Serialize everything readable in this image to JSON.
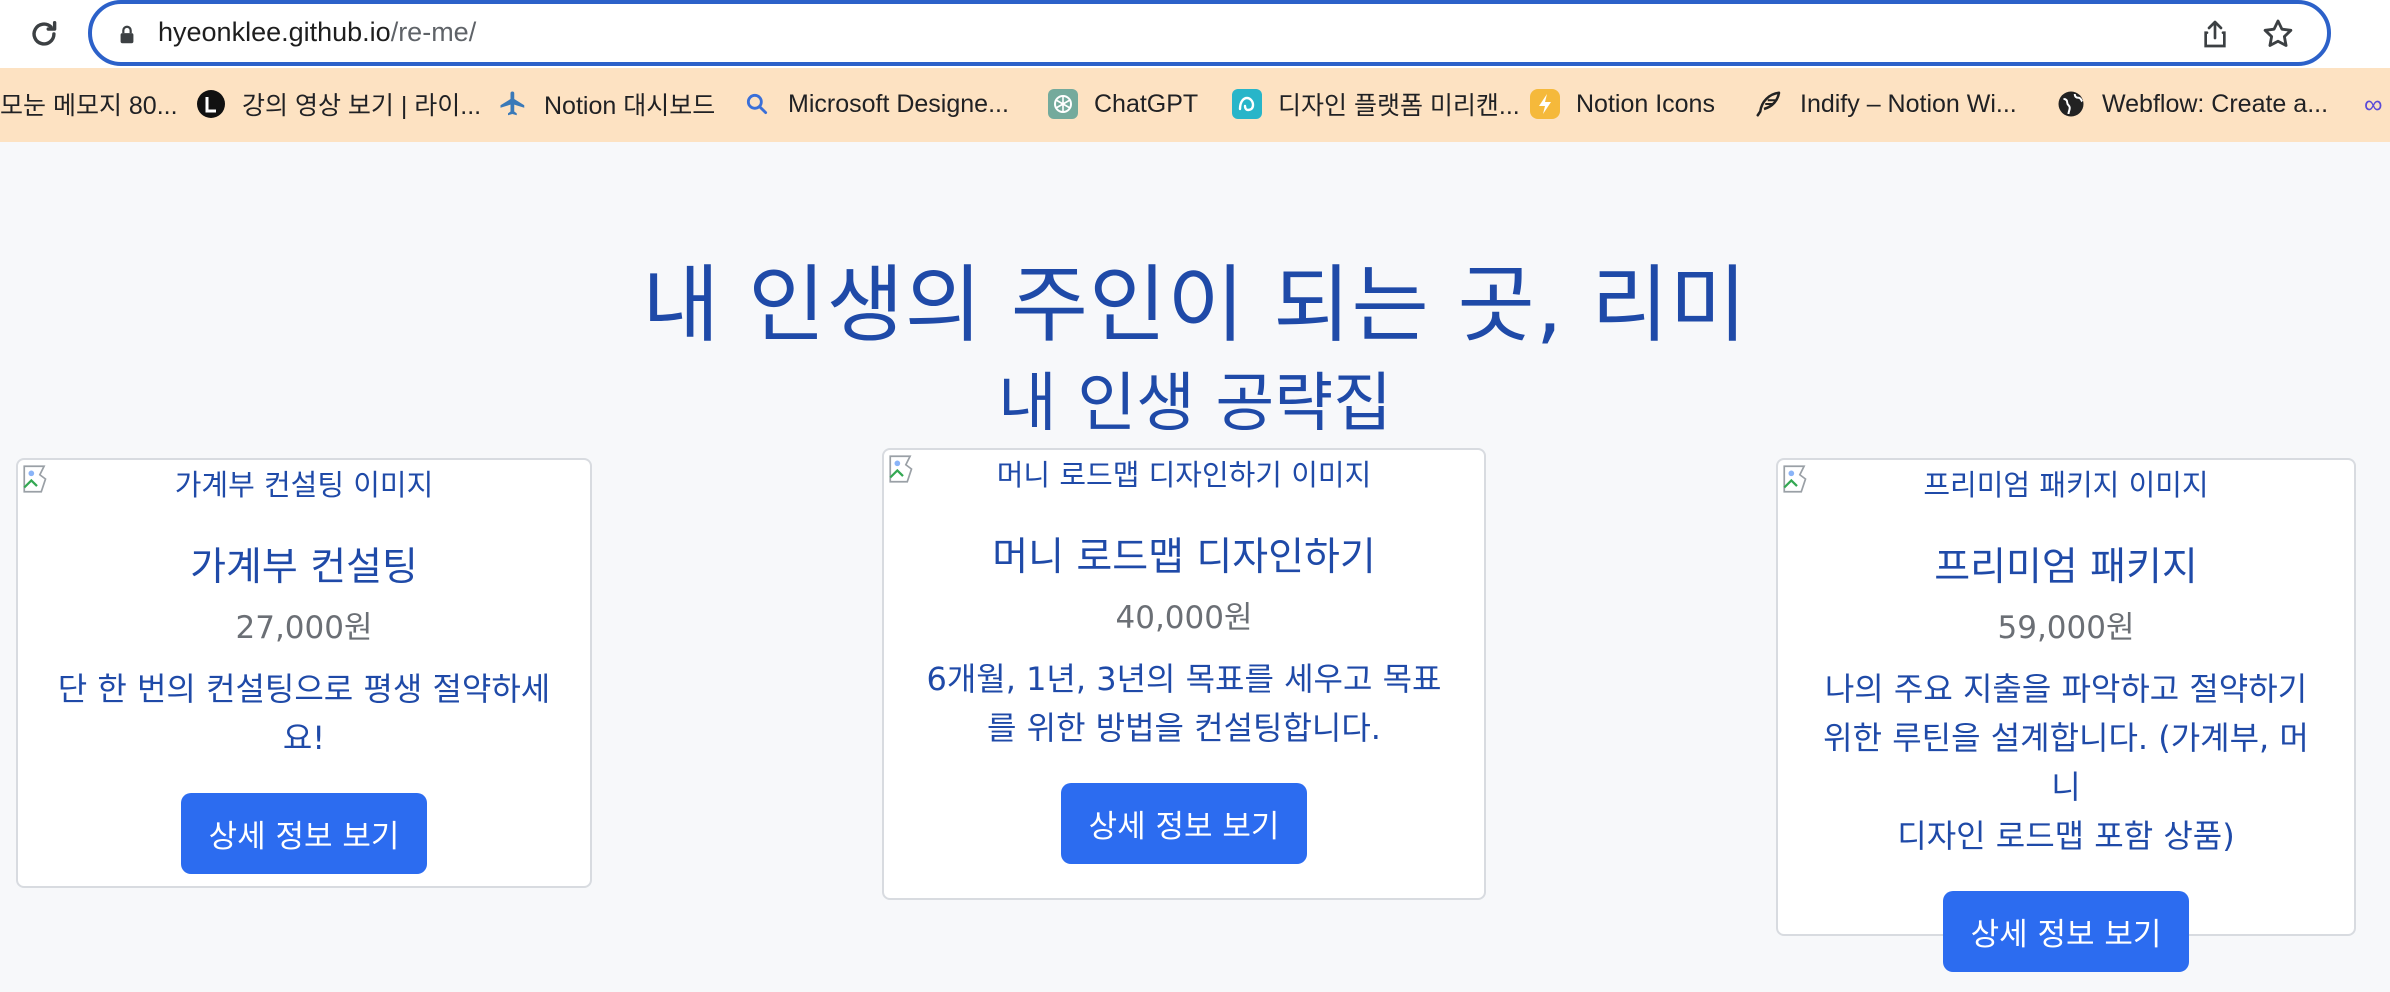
{
  "browser": {
    "url_host": "hyeonklee.github.io",
    "url_path": "/re-me/",
    "bookmarks": [
      {
        "label": "모눈 메모지 80...",
        "icon": "none"
      },
      {
        "label": "강의 영상 보기 | 라이...",
        "icon": "l-logo-icon"
      },
      {
        "label": "Notion 대시보드",
        "icon": "airplane-icon"
      },
      {
        "label": "Microsoft Designe...",
        "icon": "search-icon"
      },
      {
        "label": "ChatGPT",
        "icon": "chatgpt-icon"
      },
      {
        "label": "디자인 플랫폼 미리캔...",
        "icon": "miricanvas-icon"
      },
      {
        "label": "Notion Icons",
        "icon": "bolt-icon"
      },
      {
        "label": "Indify – Notion Wi...",
        "icon": "feather-icon"
      },
      {
        "label": "Webflow: Create a...",
        "icon": "globe-icon"
      }
    ]
  },
  "page": {
    "title": "내 인생의 주인이 되는 곳, 리미",
    "subtitle": "내 인생 공략집"
  },
  "cards": [
    {
      "image_alt": "가계부 컨설팅 이미지",
      "title": "가계부 컨설팅",
      "price": "27,000원",
      "desc_lines": [
        "단 한 번의 컨설팅으로 평생 절약하세",
        "요!"
      ],
      "button": "상세 정보 보기"
    },
    {
      "image_alt": "머니 로드맵 디자인하기 이미지",
      "title": "머니 로드맵 디자인하기",
      "price": "40,000원",
      "desc_lines": [
        "6개월, 1년, 3년의 목표를 세우고 목표",
        "를 위한 방법을 컨설팅합니다."
      ],
      "button": "상세 정보 보기"
    },
    {
      "image_alt": "프리미엄 패키지 이미지",
      "title": "프리미엄 패키지",
      "price": "59,000원",
      "desc_lines": [
        "나의 주요 지출을 파악하고 절약하기",
        "위한 루틴을 설계합니다. (가계부, 머니",
        "디자인 로드맵 포함 상품)"
      ],
      "button": "상세 정보 보기"
    }
  ],
  "colors": {
    "accent": "#2c6cf0",
    "heading": "#1f4aa8",
    "bookmark_bar": "#fde2c2"
  }
}
